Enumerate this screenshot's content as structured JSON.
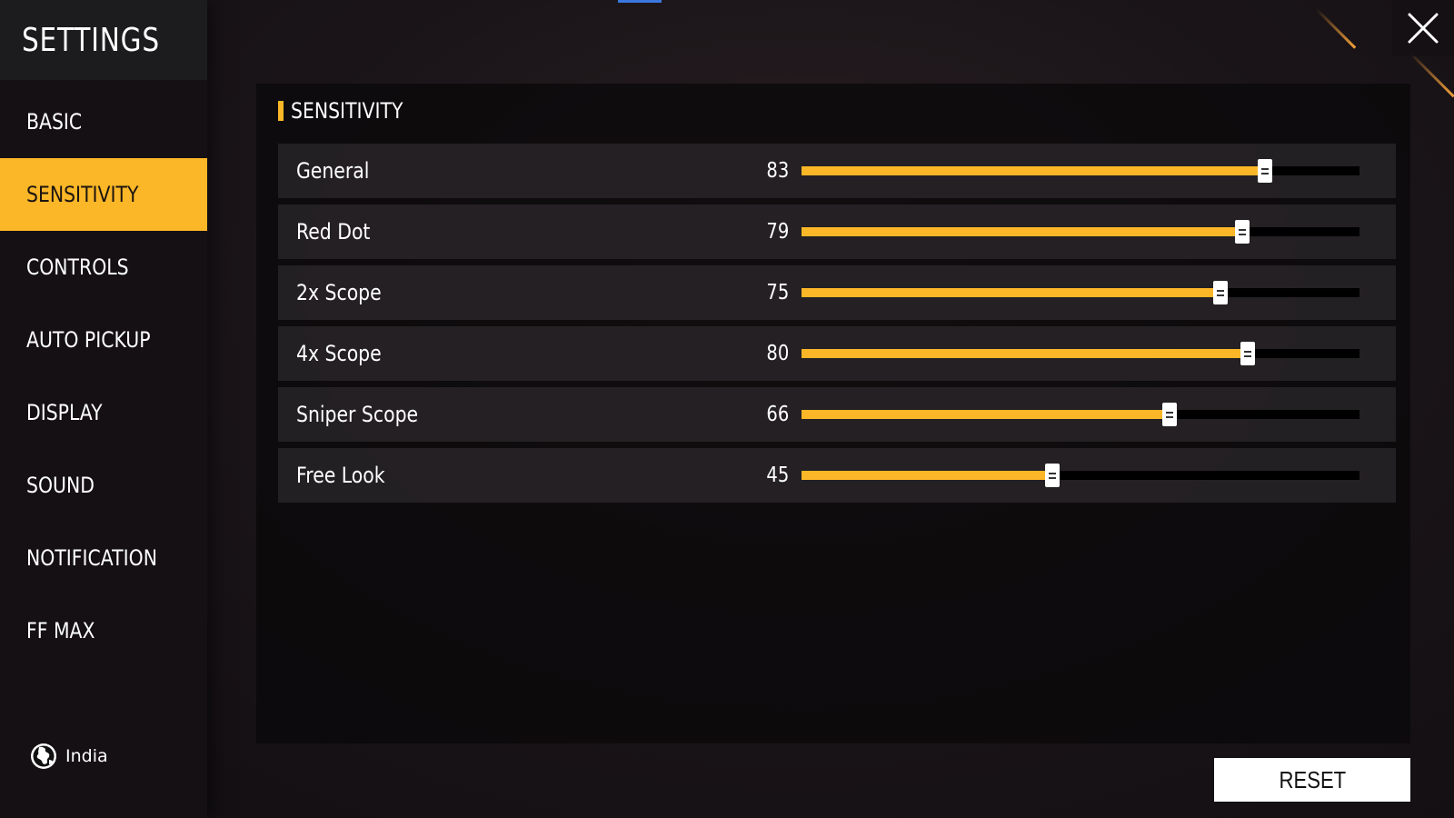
{
  "sidebar": {
    "title": "SETTINGS",
    "items": [
      {
        "label": "BASIC",
        "active": false
      },
      {
        "label": "SENSITIVITY",
        "active": true
      },
      {
        "label": "CONTROLS",
        "active": false
      },
      {
        "label": "AUTO PICKUP",
        "active": false
      },
      {
        "label": "DISPLAY",
        "active": false
      },
      {
        "label": "SOUND",
        "active": false
      },
      {
        "label": "NOTIFICATION",
        "active": false
      },
      {
        "label": "FF MAX",
        "active": false
      }
    ],
    "region": {
      "icon": "globe-icon",
      "label": "India"
    }
  },
  "panel": {
    "title": "SENSITIVITY",
    "slider_range": [
      0,
      100
    ],
    "rows": [
      {
        "label": "General",
        "value": 83
      },
      {
        "label": "Red Dot",
        "value": 79
      },
      {
        "label": "2x Scope",
        "value": 75
      },
      {
        "label": "4x Scope",
        "value": 80
      },
      {
        "label": "Sniper Scope",
        "value": 66
      },
      {
        "label": "Free Look",
        "value": 45
      }
    ]
  },
  "buttons": {
    "reset_label": "RESET",
    "close_icon": "close-icon"
  },
  "colors": {
    "accent": "#fbb727",
    "track": "#000000",
    "thumb": "#ffffff"
  }
}
